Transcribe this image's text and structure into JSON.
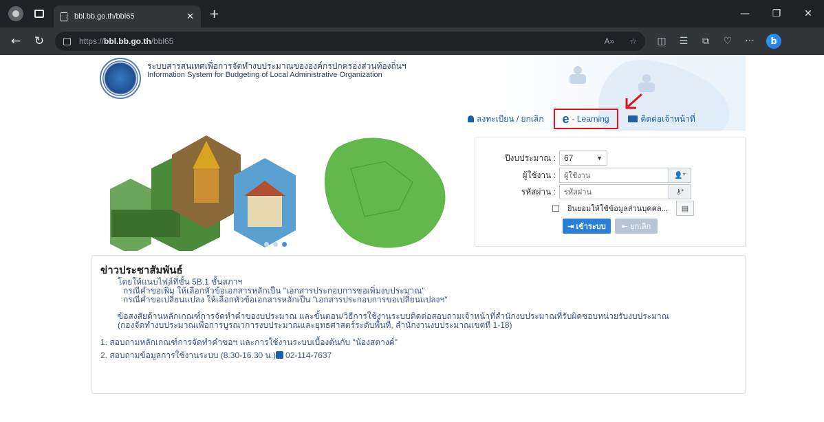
{
  "browser": {
    "tab_title": "bbl.bb.go.th/bbl65",
    "url_prefix": "https://",
    "url_host": "bbl.bb.go.th",
    "url_path": "/bbl65"
  },
  "site": {
    "title_th": "ระบบสารสนเทศเพื่อการจัดทำงบประมาณขององค์กรปกครองส่วนท้องถิ่นฯ",
    "title_en": "Information System for Budgeting of Local Administrative Organization"
  },
  "nav": {
    "register_label": "ลงทะเบียน / ยกเลิก",
    "elearning_letter": "e",
    "elearning_label": "- Learning",
    "contact_label": "ติดต่อเจ้าหน้าที่"
  },
  "login": {
    "year_label": "ปีงบประมาณ :",
    "year_value": "67",
    "user_label": "ผู้ใช้งาน :",
    "user_placeholder": "ผู้ใช้งาน",
    "pass_label": "รหัสผ่าน :",
    "pass_placeholder": "รหัสผ่าน",
    "consent_label": "ยินยอมให้ใช้ข้อมูลส่วนบุคคล...",
    "login_button": "เข้าระบบ",
    "cancel_button": "ยกเลิก"
  },
  "news": {
    "title": "ข่าวประชาสัมพันธ์",
    "line1": "โดยให้แนบไฟล์ที่ขั้น 5B.1 ขั้นสภาฯ",
    "line2": "กรณีคำขอเพิ่ม ให้เลือกหัวข้อเอกสารหลักเป็น \"เอกสารประกอบการขอเพิ่มงบประมาณ\"",
    "line3": "กรณีคำขอเปลี่ยนแปลง ให้เลือกหัวข้อเอกสารหลักเป็น \"เอกสารประกอบการขอเปลี่ยนแปลงฯ\"",
    "line4": "ข้อสงสัยด้านหลักเกณฑ์การจัดทำคำของบประมาณ และขั้นตอน/วิธีการใช้งานระบบติดต่อสอบถามเจ้าหน้าที่สำนักงบประมาณที่รับผิดชอบหน่วยรับงบประมาณ",
    "line5": "(กองจัดทำงบประมาณเพื่อการบูรณาการงบประมาณและยุทธศาสตร์ระดับพื้นที่, สำนักงานงบประมาณเขตที่ 1-18)",
    "item1": "1.  สอบถามหลักเกณฑ์การจัดทำคำขอฯ และการใช้งานระบบเบื้องต้นกับ \"น้องสตางค์\"",
    "item2_prefix": "2.  สอบถามข้อมูลการใช้งานระบบ (8.30-16.30 น.)",
    "item2_phone": "02-114-7637"
  }
}
